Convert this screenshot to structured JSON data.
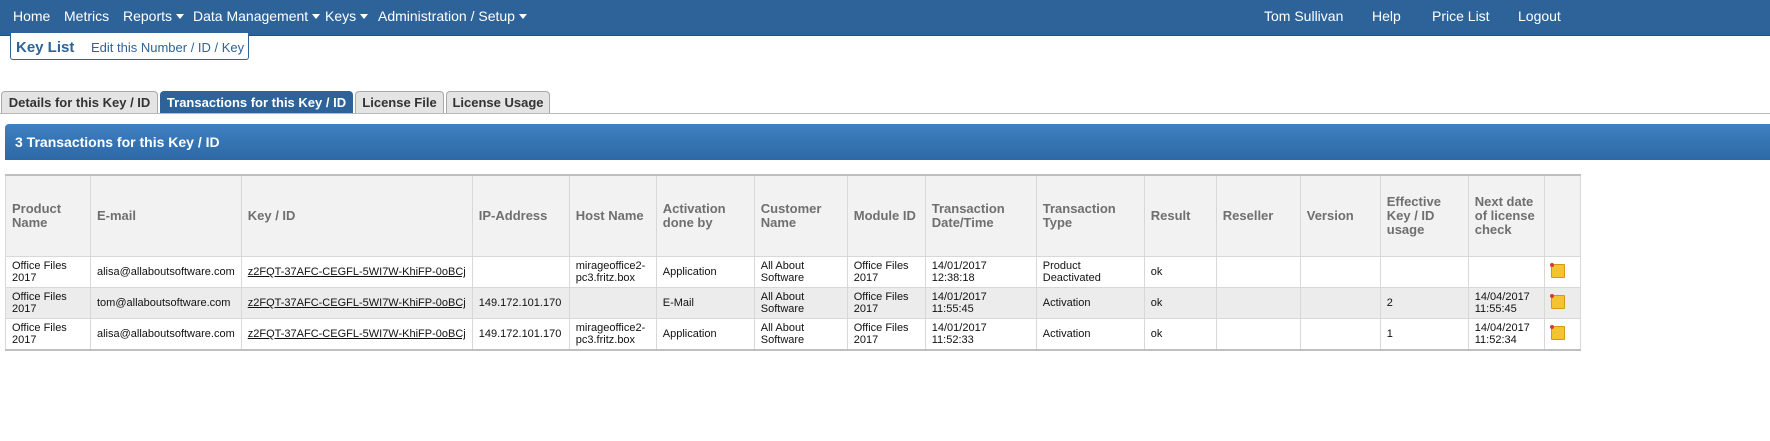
{
  "nav": {
    "home": "Home",
    "metrics": "Metrics",
    "reports": "Reports",
    "data_management": "Data Management",
    "keys": "Keys",
    "admin_setup": "Administration / Setup",
    "user": "Tom Sullivan",
    "help": "Help",
    "price_list": "Price List",
    "logout": "Logout"
  },
  "key_box": {
    "title": "Key List",
    "edit_link": "Edit this Number / ID / Key"
  },
  "tabs": [
    {
      "label": "Details for this Key / ID",
      "active": false
    },
    {
      "label": "Transactions for this Key / ID",
      "active": true
    },
    {
      "label": "License File",
      "active": false
    },
    {
      "label": "License Usage",
      "active": false
    }
  ],
  "panel": {
    "title": "3 Transactions for this Key / ID"
  },
  "table": {
    "headers": [
      "Product Name",
      "E-mail",
      "Key / ID",
      "IP-Address",
      "Host Name",
      "Activation done by",
      "Customer Name",
      "Module ID",
      "Transaction Date/Time",
      "Transaction Type",
      "Result",
      "Reseller",
      "Version",
      "Effective Key / ID usage",
      "Next date of license check",
      ""
    ],
    "rows": [
      {
        "product": "Office Files 2017",
        "email": "alisa@allaboutsoftware.com",
        "key": "z2FQT-37AFC-CEGFL-5WI7W-KhiFP-0oBCj",
        "ip": "",
        "host": "mirageoffice2-pc3.fritz.box",
        "activation_by": "Application",
        "customer": "All About Software",
        "module": "Office Files 2017",
        "datetime": "14/01/2017 12:38:18",
        "type": "Product Deactivated",
        "result": "ok",
        "reseller": "",
        "version": "",
        "usage": "",
        "next_check": "",
        "icon": "note-icon"
      },
      {
        "product": "Office Files 2017",
        "email": "tom@allaboutsoftware.com",
        "key": "z2FQT-37AFC-CEGFL-5WI7W-KhiFP-0oBCj",
        "ip": "149.172.101.170",
        "host": "",
        "activation_by": "E-Mail",
        "customer": "All About Software",
        "module": "Office Files 2017",
        "datetime": "14/01/2017 11:55:45",
        "type": "Activation",
        "result": "ok",
        "reseller": "",
        "version": "",
        "usage": "2",
        "next_check": "14/04/2017 11:55:45",
        "icon": "note-icon"
      },
      {
        "product": "Office Files 2017",
        "email": "alisa@allaboutsoftware.com",
        "key": "z2FQT-37AFC-CEGFL-5WI7W-KhiFP-0oBCj",
        "ip": "149.172.101.170",
        "host": "mirageoffice2-pc3.fritz.box",
        "activation_by": "Application",
        "customer": "All About Software",
        "module": "Office Files 2017",
        "datetime": "14/01/2017 11:52:33",
        "type": "Activation",
        "result": "ok",
        "reseller": "",
        "version": "",
        "usage": "1",
        "next_check": "14/04/2017 11:52:34",
        "icon": "note-icon"
      }
    ]
  },
  "colors": {
    "nav_bg": "#2e6399",
    "accent": "#2e6399",
    "panel_header": "#3a78b6",
    "note_icon": "#f4c430"
  }
}
